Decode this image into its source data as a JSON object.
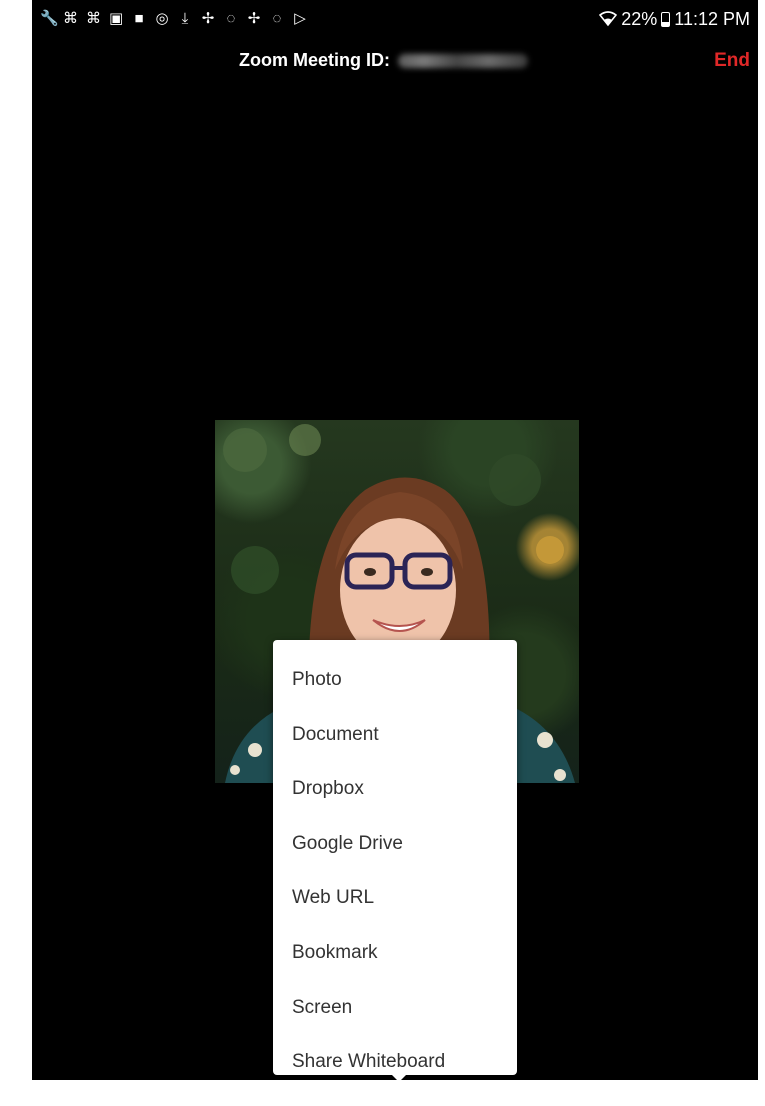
{
  "status_bar": {
    "notification_icons": [
      {
        "name": "wrench-icon",
        "glyph": "🔧"
      },
      {
        "name": "usb-icon",
        "glyph": "⌘"
      },
      {
        "name": "usb-icon-2",
        "glyph": "⌘"
      },
      {
        "name": "image-icon",
        "glyph": "▣"
      },
      {
        "name": "video-camera-icon",
        "glyph": "■"
      },
      {
        "name": "location-icon",
        "glyph": "◎"
      },
      {
        "name": "download-icon",
        "glyph": "⤓"
      },
      {
        "name": "pinwheel-icon",
        "glyph": "✢"
      },
      {
        "name": "bag-icon",
        "glyph": "◌"
      },
      {
        "name": "pinwheel-icon-2",
        "glyph": "✢"
      },
      {
        "name": "bag-icon-2",
        "glyph": "◌"
      },
      {
        "name": "play-store-icon",
        "glyph": "▷"
      }
    ],
    "battery": "22%",
    "time": "11:12 PM"
  },
  "header": {
    "title": "Zoom Meeting ID:",
    "end_label": "End"
  },
  "share_menu": {
    "items": [
      "Photo",
      "Document",
      "Dropbox",
      "Google Drive",
      "Web URL",
      "Bookmark",
      "Screen",
      "Share Whiteboard"
    ]
  },
  "colors": {
    "background": "#000000",
    "end_red": "#e02828",
    "menu_bg": "#ffffff",
    "menu_text": "#333333"
  }
}
